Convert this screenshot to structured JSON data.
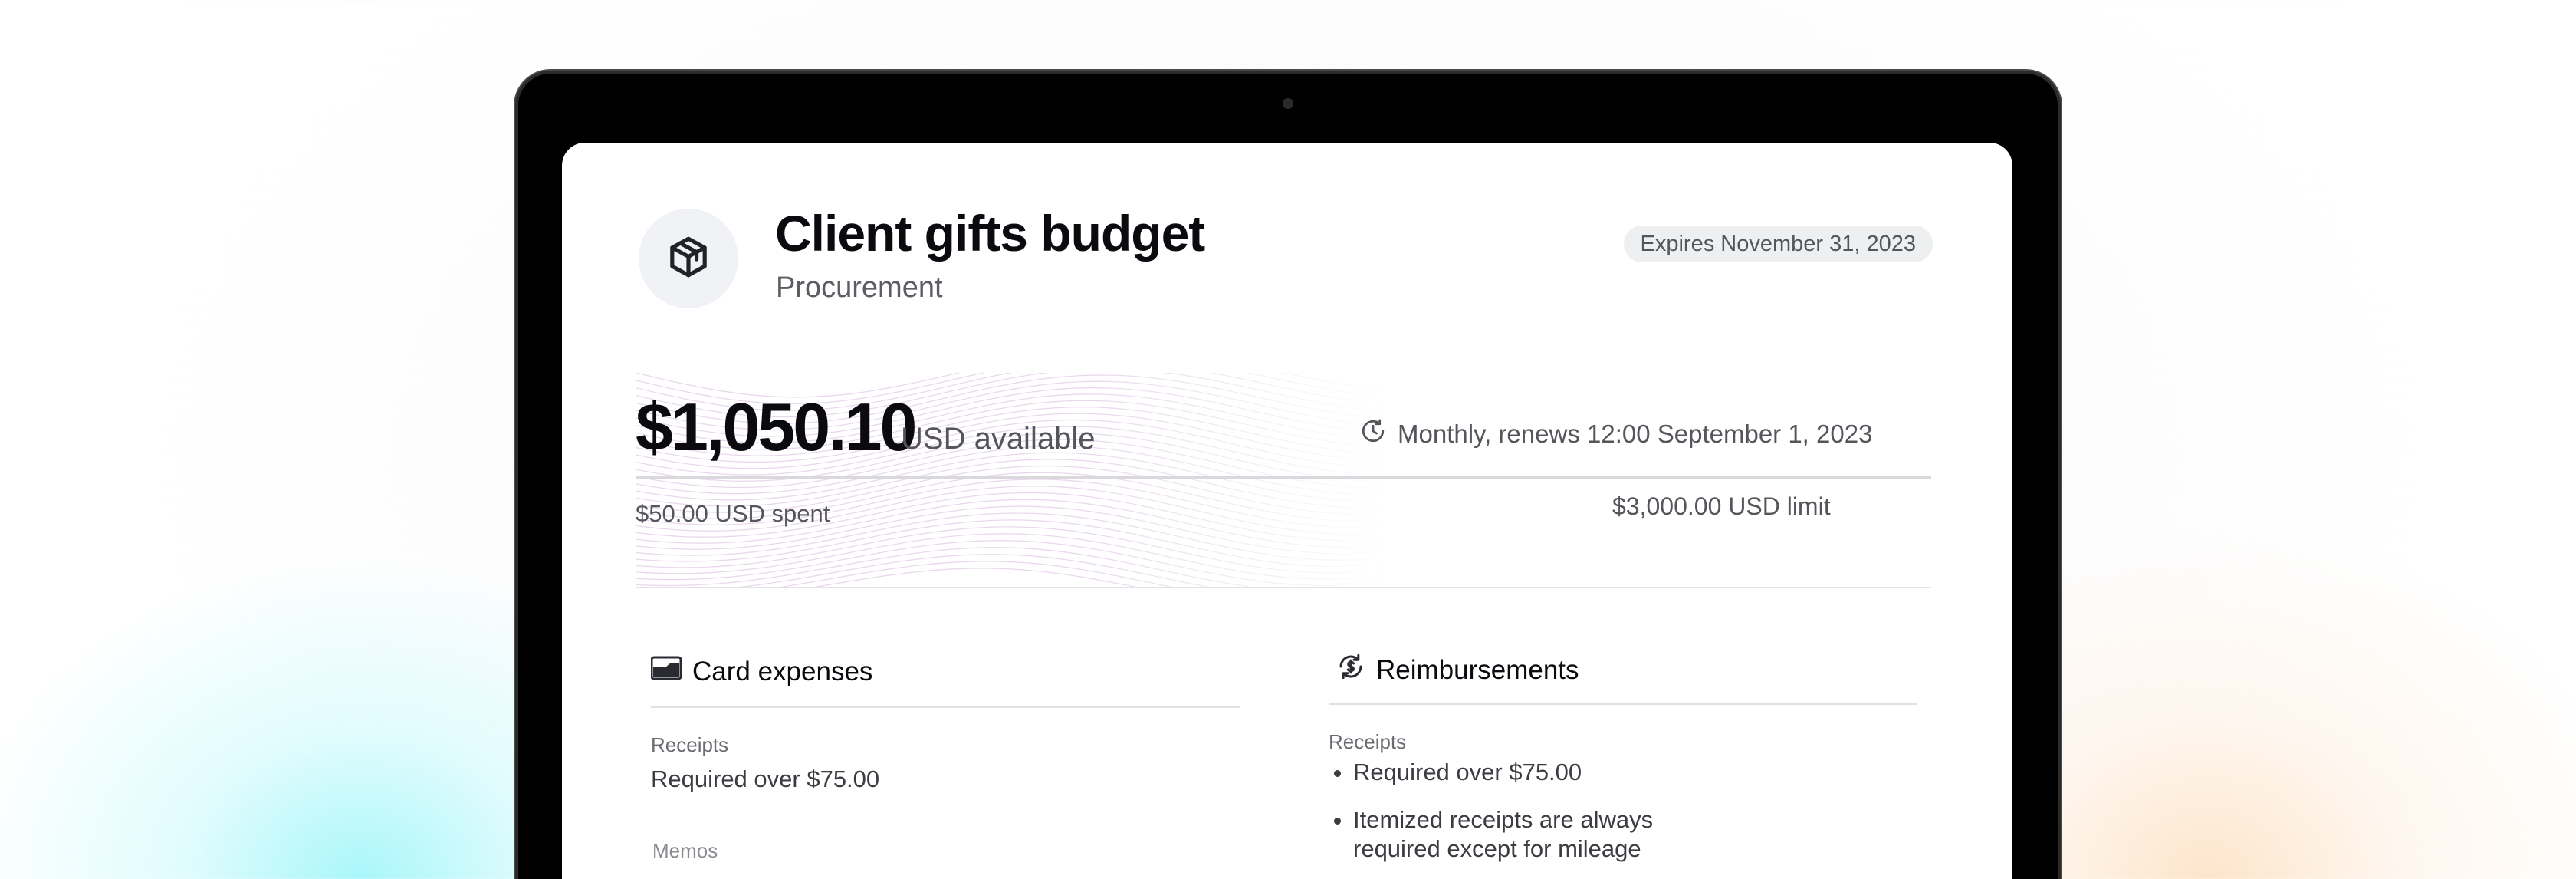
{
  "budget": {
    "title": "Client gifts budget",
    "department": "Procurement",
    "icon": "box-icon",
    "expires": "Expires November 31, 2023"
  },
  "balance": {
    "amount": "$1,050.10",
    "amount_suffix": "USD available",
    "renewal": "Monthly, renews 12:00 September 1, 2023",
    "renewal_icon": "clock-icon",
    "spent": "$50.00 USD spent",
    "limit": "$3,000.00 USD limit"
  },
  "card_expenses": {
    "title": "Card expenses",
    "icon": "card-icon",
    "receipts_label": "Receipts",
    "receipts_value": "Required over $75.00",
    "memos_label": "Memos"
  },
  "reimbursements": {
    "title": "Reimbursements",
    "icon": "dollar-cycle-icon",
    "receipts_label": "Receipts",
    "items": [
      "Required over $75.00",
      "Itemized receipts are always required except for mileage"
    ]
  },
  "colors": {
    "background_left_glow": "#a5f6fa",
    "background_right_glow": "#fde2c6",
    "wave_lines": "#e9d8ec",
    "text_primary": "#0b0b0f",
    "text_secondary": "#55565c"
  }
}
